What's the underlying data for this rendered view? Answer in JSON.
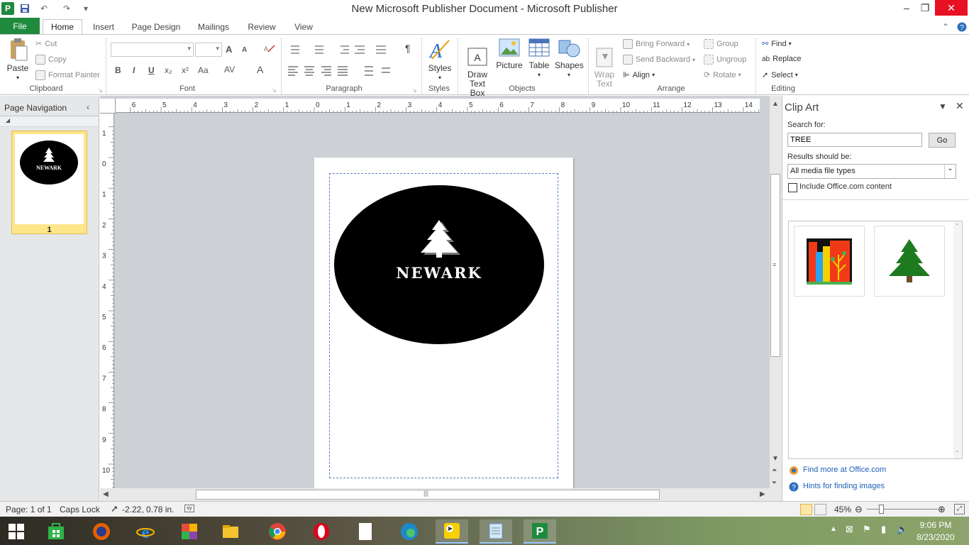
{
  "window": {
    "title": "New Microsoft Publisher Document  -  Microsoft Publisher",
    "minimize": "–",
    "restore": "❐",
    "close": "✕"
  },
  "qat": {
    "app_icon": "P",
    "save": "save-icon",
    "undo": "↶",
    "redo": "↷",
    "customize": "▾"
  },
  "tabs": [
    "File",
    "Home",
    "Insert",
    "Page Design",
    "Mailings",
    "Review",
    "View"
  ],
  "active_tab": "Home",
  "ribbon": {
    "clipboard": {
      "paste": "Paste",
      "cut": "Cut",
      "copy": "Copy",
      "format_painter": "Format Painter",
      "label": "Clipboard"
    },
    "font": {
      "label": "Font",
      "bold": "B",
      "italic": "I",
      "underline": "U",
      "subscript": "x₂",
      "superscript": "x²",
      "change_case": "Aa",
      "grow": "A",
      "shrink": "A",
      "spacing": "AV",
      "color": "A"
    },
    "paragraph": {
      "label": "Paragraph",
      "pilcrow": "¶"
    },
    "styles": {
      "label": "Styles",
      "button": "Styles"
    },
    "objects": {
      "label": "Objects",
      "draw_text_box": "Draw\nText Box",
      "picture": "Picture",
      "table": "Table",
      "shapes": "Shapes"
    },
    "arrange": {
      "label": "Arrange",
      "wrap_text": "Wrap\nText",
      "bring_forward": "Bring Forward",
      "send_backward": "Send Backward",
      "align": "Align",
      "group": "Group",
      "ungroup": "Ungroup",
      "rotate": "Rotate"
    },
    "editing": {
      "label": "Editing",
      "find": "Find",
      "replace": "Replace",
      "select": "Select"
    }
  },
  "page_navigation": {
    "title": "Page Navigation",
    "page_number": "1"
  },
  "ruler": {
    "h_labels": [
      "6",
      "5",
      "4",
      "3",
      "2",
      "1",
      "0",
      "1",
      "2",
      "3",
      "4",
      "5",
      "6",
      "7",
      "8",
      "9",
      "10",
      "11",
      "12",
      "13",
      "14"
    ],
    "v_labels": [
      "1",
      "0",
      "1",
      "2",
      "3",
      "4",
      "5",
      "6",
      "7",
      "8",
      "9",
      "10"
    ]
  },
  "document": {
    "logo_text": "NEWARK"
  },
  "clip_art": {
    "title": "Clip Art",
    "search_label": "Search for:",
    "search_value": "TREE",
    "go_button": "Go",
    "results_label": "Results should be:",
    "results_value": "All media file types",
    "include_office": "Include Office.com content",
    "find_more": "Find more at Office.com",
    "hints": "Hints for finding images"
  },
  "status": {
    "page": "Page: 1 of 1",
    "caps": "Caps Lock",
    "position": "-2.22, 0.78 in.",
    "zoom": "45%"
  },
  "taskbar": {
    "time": "9:06 PM",
    "date": "8/23/2020"
  }
}
